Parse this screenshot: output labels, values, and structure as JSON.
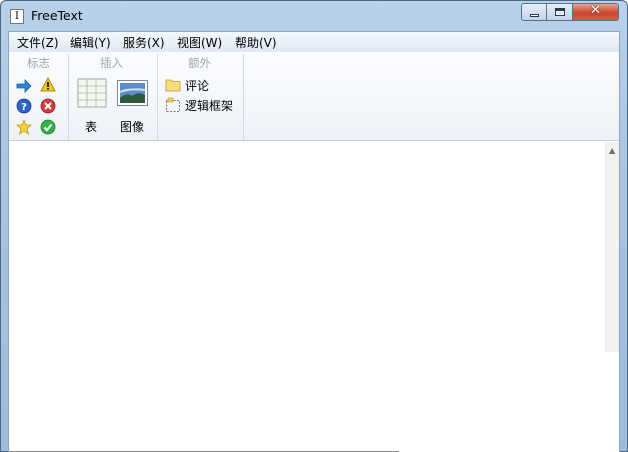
{
  "window": {
    "title": "FreeText",
    "icon_glyph": "I",
    "controls": {
      "minimize": "minimize-icon",
      "maximize": "maximize-icon",
      "close": "✕"
    }
  },
  "menu": {
    "items": [
      "文件(Z)",
      "编辑(Y)",
      "服务(X)",
      "视图(W)",
      "帮助(V)"
    ]
  },
  "toolbar": {
    "groups": {
      "flags": {
        "title": "标志",
        "icons": [
          "arrow-right-icon",
          "warning-icon",
          "help-icon",
          "error-icon",
          "star-icon",
          "ok-icon"
        ]
      },
      "insert": {
        "title": "插入",
        "table_label": "表",
        "image_label": "图像"
      },
      "extra": {
        "title": "额外",
        "comment_label": "评论",
        "frame_label": "逻辑框架"
      }
    }
  },
  "colors": {
    "title_gradient_top": "#b9d1ea",
    "close_red": "#c9472f",
    "group_title": "#a2a7ae"
  }
}
